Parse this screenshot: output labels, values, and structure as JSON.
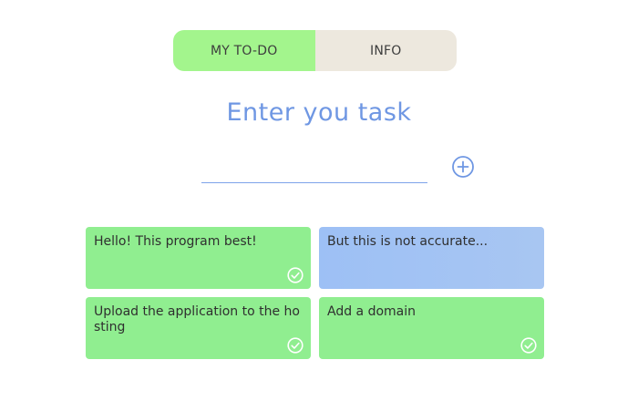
{
  "tabs": [
    {
      "label": "MY TO-DO",
      "active": true
    },
    {
      "label": "INFO",
      "active": false
    }
  ],
  "heading": "Enter you task",
  "task_input": {
    "value": "",
    "placeholder": ""
  },
  "add_button": {
    "icon": "plus-circle-icon"
  },
  "tasks": [
    {
      "text": "Hello! This program best!",
      "done": true
    },
    {
      "text": "But this is not accurate...",
      "done": false
    },
    {
      "text": "Upload the application to the hosting",
      "done": true
    },
    {
      "text": "Add a domain",
      "done": true
    }
  ],
  "colors": {
    "tab_active": "#a3f58d",
    "tab_inactive": "#ede8de",
    "accent": "#6f97e3",
    "card_done": "#90ee90",
    "card_pending": "#a3c3f4",
    "check_icon": "#ffffff"
  }
}
